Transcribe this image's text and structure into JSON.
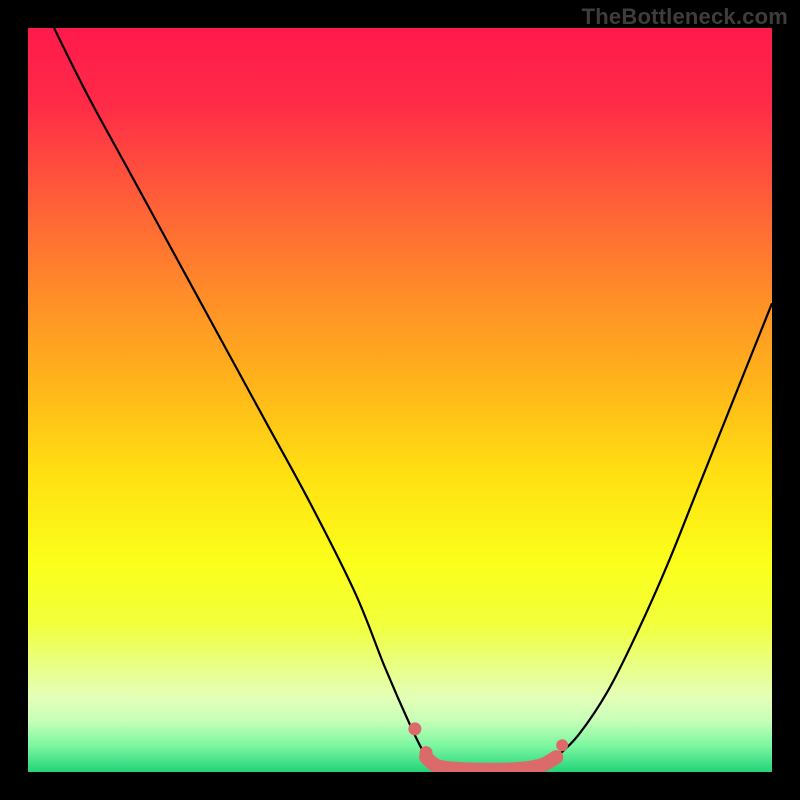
{
  "attribution": "TheBottleneck.com",
  "chart_data": {
    "type": "line",
    "title": "",
    "xlabel": "",
    "ylabel": "",
    "xlim": [
      0,
      100
    ],
    "ylim": [
      0,
      100
    ],
    "background_gradient": {
      "stops": [
        {
          "offset": 0.0,
          "color": "#ff1a4b"
        },
        {
          "offset": 0.1,
          "color": "#ff2a48"
        },
        {
          "offset": 0.22,
          "color": "#ff5a3a"
        },
        {
          "offset": 0.35,
          "color": "#ff8a2a"
        },
        {
          "offset": 0.48,
          "color": "#ffb51a"
        },
        {
          "offset": 0.6,
          "color": "#ffe012"
        },
        {
          "offset": 0.72,
          "color": "#fbff1a"
        },
        {
          "offset": 0.8,
          "color": "#f2ff3a"
        },
        {
          "offset": 0.86,
          "color": "#e8ff88"
        },
        {
          "offset": 0.9,
          "color": "#e4ffb8"
        },
        {
          "offset": 0.93,
          "color": "#c8ffb8"
        },
        {
          "offset": 0.965,
          "color": "#7bf7a0"
        },
        {
          "offset": 1.0,
          "color": "#22d37a"
        }
      ]
    },
    "series": [
      {
        "name": "left-curve",
        "color": "#000000",
        "width": 2.2,
        "x": [
          3.5,
          8,
          14,
          20,
          26,
          32,
          38,
          44,
          48,
          51.5,
          53.5
        ],
        "y": [
          100,
          91,
          80,
          69,
          58,
          47,
          36,
          24,
          14,
          6,
          2
        ]
      },
      {
        "name": "right-curve",
        "color": "#000000",
        "width": 2.2,
        "x": [
          71,
          74,
          78,
          82,
          86,
          90,
          94,
          98,
          100
        ],
        "y": [
          2,
          5,
          11,
          19,
          28,
          38,
          48,
          58,
          63
        ]
      },
      {
        "name": "bottom-band",
        "color": "#dd6a6a",
        "width": 14,
        "linecap": "round",
        "x": [
          53.5,
          55,
          58,
          62,
          66,
          69,
          71
        ],
        "y": [
          2,
          0.8,
          0.4,
          0.3,
          0.4,
          0.9,
          2
        ]
      }
    ],
    "markers": [
      {
        "name": "left-dot-upper",
        "x": 52.0,
        "y": 5.8,
        "r": 6.5,
        "color": "#dd6a6a"
      },
      {
        "name": "left-dot-lower",
        "x": 53.5,
        "y": 2.6,
        "r": 6.5,
        "color": "#dd6a6a"
      },
      {
        "name": "right-dot-upper",
        "x": 71.8,
        "y": 3.6,
        "r": 6.0,
        "color": "#dd6a6a"
      },
      {
        "name": "right-dot-lower",
        "x": 70.2,
        "y": 1.6,
        "r": 6.0,
        "color": "#dd6a6a"
      }
    ]
  }
}
